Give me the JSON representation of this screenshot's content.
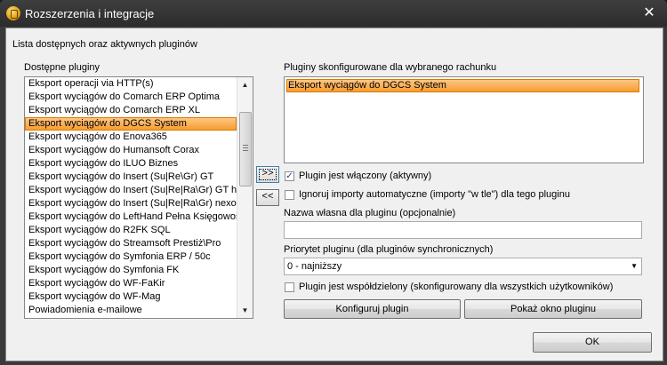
{
  "window": {
    "title": "Rozszerzenia i integracje",
    "close_label": "✕"
  },
  "header_label": "Lista dostępnych oraz aktywnych pluginów",
  "available": {
    "label": "Dostępne pluginy",
    "selected_index": 3,
    "items": [
      "Eksport operacji via HTTP(s)",
      "Eksport wyciągów do Comarch ERP Optima",
      "Eksport wyciągów do Comarch ERP XL",
      "Eksport wyciągów do DGCS System",
      "Eksport wyciągów do Enova365",
      "Eksport wyciągów do Humansoft Corax",
      "Eksport wyciągów do ILUO Biznes",
      "Eksport wyciągów do Insert (Su|Re\\Gr) GT",
      "Eksport wyciągów do Insert (Su|Re|Ra\\Gr) GT h",
      "Eksport wyciągów do Insert (Su|Re|Ra\\Gr) nexo",
      "Eksport wyciągów do LeftHand Pełna Księgowość",
      "Eksport wyciągów do R2FK SQL",
      "Eksport wyciągów do Streamsoft Prestiż\\Pro",
      "Eksport wyciągów do Symfonia ERP  / 50c",
      "Eksport wyciągów do Symfonia FK",
      "Eksport wyciągów do WF-FaKir",
      "Eksport wyciągów do WF-Mag",
      "Powiadomienia e-mailowe"
    ]
  },
  "buttons": {
    "add": ">>",
    "remove": "<<",
    "configure": "Konfiguruj plugin",
    "show_window": "Pokaż okno pluginu",
    "ok": "OK"
  },
  "configured": {
    "label": "Pluginy skonfigurowane dla wybranego rachunku",
    "items": [
      "Eksport wyciągów do DGCS System"
    ]
  },
  "options": {
    "enabled_label": "Plugin jest włączony (aktywny)",
    "enabled_checked": true,
    "ignore_label": "Ignoruj importy automatyczne (importy \"w tle\") dla tego pluginu",
    "ignore_checked": false,
    "custom_name_label": "Nazwa własna dla pluginu (opcjonalnie)",
    "custom_name_value": "",
    "priority_label": "Priorytet pluginu (dla pluginów synchronicznych)",
    "priority_value": "0 - najniższy",
    "shared_label": "Plugin jest współdzielony (skonfigurowany dla wszystkich użytkowników)",
    "shared_checked": false
  }
}
